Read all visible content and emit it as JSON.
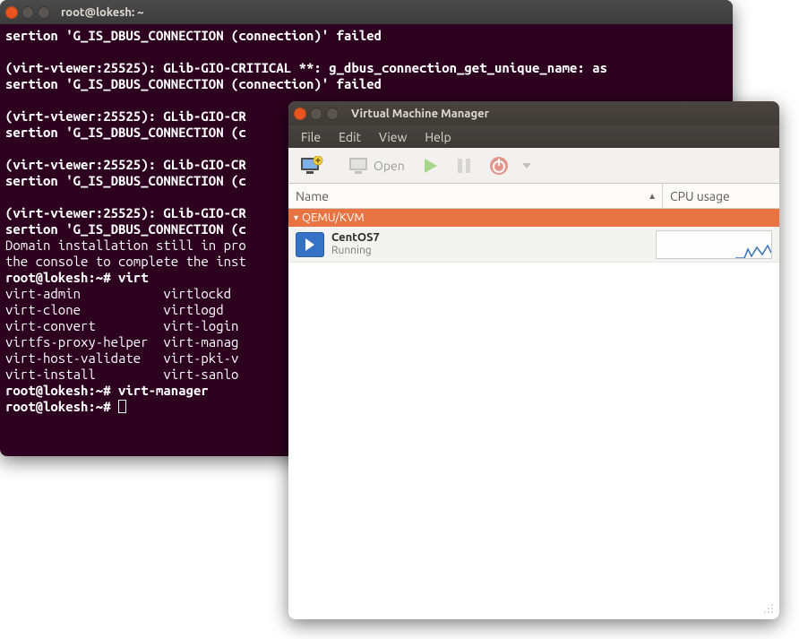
{
  "terminal": {
    "window_title": "root@lokesh: ~",
    "lines": [
      "sertion 'G_IS_DBUS_CONNECTION (connection)' failed",
      "",
      "(virt-viewer:25525): GLib-GIO-CRITICAL **: g_dbus_connection_get_unique_name: as",
      "sertion 'G_IS_DBUS_CONNECTION (connection)' failed",
      "",
      "(virt-viewer:25525): GLib-GIO-CR",
      "sertion 'G_IS_DBUS_CONNECTION (c",
      "",
      "(virt-viewer:25525): GLib-GIO-CR",
      "sertion 'G_IS_DBUS_CONNECTION (c",
      "",
      "(virt-viewer:25525): GLib-GIO-CR",
      "sertion 'G_IS_DBUS_CONNECTION (c",
      "Domain installation still in pro",
      "the console to complete the inst",
      "root@lokesh:~# virt",
      "virt-admin           virtlockd",
      "virt-clone           virtlogd",
      "virt-convert         virt-login",
      "virtfs-proxy-helper  virt-manag",
      "virt-host-validate   virt-pki-v",
      "virt-install         virt-sanlo",
      "root@lokesh:~# virt-manager",
      "root@lokesh:~# "
    ]
  },
  "vmm": {
    "window_title": "Virtual Machine Manager",
    "menu": {
      "file": "File",
      "edit": "Edit",
      "view": "View",
      "help": "Help"
    },
    "toolbar": {
      "open_label": "Open"
    },
    "columns": {
      "name": "Name",
      "cpu": "CPU usage"
    },
    "group": "QEMU/KVM",
    "vm": {
      "name": "CentOS7",
      "state": "Running"
    }
  }
}
